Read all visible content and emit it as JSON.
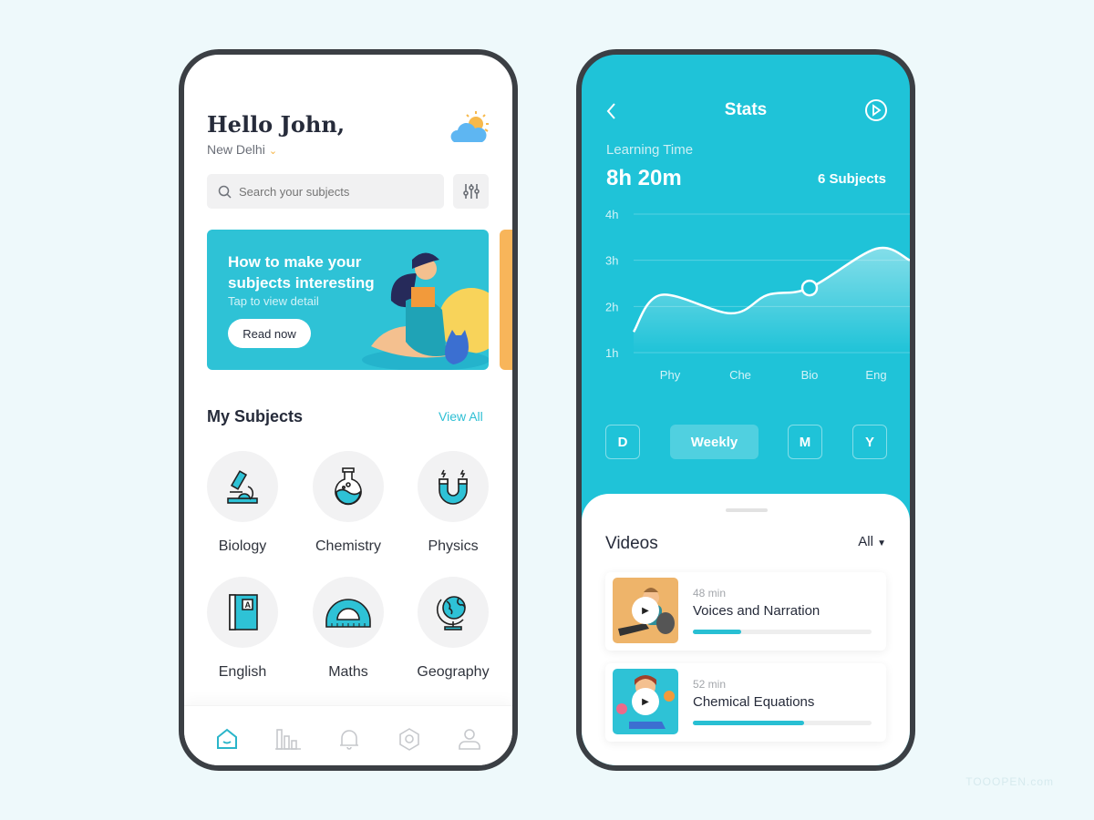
{
  "home": {
    "greeting": "Hello John,",
    "location": "New Delhi",
    "weather_icon": "sun-cloud-icon",
    "search": {
      "placeholder": "Search your subjects",
      "value": ""
    },
    "banner": {
      "title": "How to make your subjects interesting",
      "subtitle": "Tap to view detail",
      "button": "Read now"
    },
    "section_title": "My Subjects",
    "view_all": "View All",
    "subjects": [
      {
        "label": "Biology",
        "icon": "microscope-icon"
      },
      {
        "label": "Chemistry",
        "icon": "flask-icon"
      },
      {
        "label": "Physics",
        "icon": "magnet-icon"
      },
      {
        "label": "English",
        "icon": "book-icon"
      },
      {
        "label": "Maths",
        "icon": "protractor-icon"
      },
      {
        "label": "Geography",
        "icon": "globe-icon"
      }
    ],
    "nav": [
      "home-icon",
      "stats-icon",
      "bell-icon",
      "settings-icon",
      "profile-icon"
    ],
    "accent": "#2ebfd4"
  },
  "stats": {
    "title": "Stats",
    "learning_label": "Learning Time",
    "learning_value": "8h 20m",
    "subjects_count": "6 Subjects",
    "periods": [
      "D",
      "Weekly",
      "M",
      "Y"
    ],
    "active_period": "Weekly",
    "background": "#1fc3d8"
  },
  "chart_data": {
    "type": "line",
    "categories": [
      "Phy",
      "Che",
      "Bio",
      "Eng"
    ],
    "values": [
      1.9,
      1.9,
      2.4,
      3.25
    ],
    "yticks": [
      "1h",
      "2h",
      "3h",
      "4h"
    ],
    "ylim": [
      1,
      4
    ],
    "grid": true,
    "highlighted": "Bio"
  },
  "videos": {
    "title": "Videos",
    "filter": "All",
    "items": [
      {
        "duration": "48 min",
        "title": "Voices and Narration",
        "progress": 0.27,
        "thumb_color": "#eeb46a"
      },
      {
        "duration": "52 min",
        "title": "Chemical Equations",
        "progress": 0.62,
        "thumb_color": "#2ec2d6"
      }
    ]
  },
  "watermark": "TOOOPEN.com"
}
